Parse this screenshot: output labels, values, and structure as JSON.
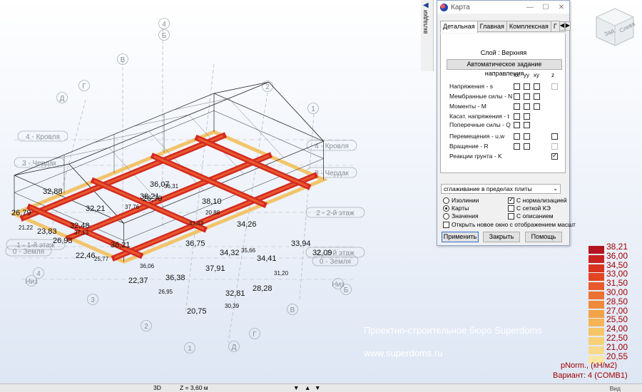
{
  "model": {
    "grid_tags": [
      "4",
      "Б",
      "В",
      "2",
      "Г",
      "Д",
      "1",
      "4 - Кровля",
      "4 - Кровля",
      "3 - Чердак",
      "3 - Чердак",
      "2 - 2-й этаж",
      "2 - 2-й этаж",
      "1 - 1-й этаж",
      "0 - Земля",
      "0 - Земля",
      "Низ",
      "Низ",
      "4",
      "3",
      "2",
      "1",
      "Д",
      "Г",
      "В",
      "Б"
    ],
    "values": [
      "26,79",
      "32,88",
      "21,22",
      "23,83",
      "26,93",
      "37,13",
      "32,48",
      "22,46",
      "25,77",
      "32,21",
      "36,07",
      "36,31",
      "26,79",
      "36,21",
      "37,76",
      "38,21",
      "38,10",
      "43,43",
      "34,26",
      "36,75",
      "35,66",
      "34,32",
      "32,09",
      "36,06",
      "22,37",
      "36,38",
      "26,95",
      "37,91",
      "20,75",
      "30,39",
      "32,81",
      "28,28",
      "31,20",
      "34,41",
      "33,94",
      "20,88"
    ]
  },
  "side_tab": {
    "label": "вкладки"
  },
  "dialog": {
    "title": "Карта",
    "controls": [
      "—",
      "☐",
      "✕"
    ],
    "tabs": [
      "Детальная",
      "Главная",
      "Комплексная",
      "Г"
    ],
    "layer_label": "Слой : Верхняя",
    "auto_button": "Автоматическое задание направления",
    "columns": [
      "xx",
      "yy",
      "xy",
      "z"
    ],
    "rows": [
      {
        "label": "Напряжения - s",
        "cols": [
          "off",
          "off",
          "off",
          "dis"
        ]
      },
      {
        "label": "Мембранные силы - N",
        "cols": [
          "off",
          "off",
          "off",
          "none"
        ]
      },
      {
        "label": "Моменты - M",
        "cols": [
          "off",
          "off",
          "off",
          "none"
        ]
      },
      {
        "label": "Касат. напряжения - t",
        "cols": [
          "off",
          "off",
          "none",
          "none"
        ]
      },
      {
        "label": "Поперечные силы - Q",
        "cols": [
          "off",
          "off",
          "none",
          "none"
        ]
      },
      {
        "label": "Перемещения - u,w",
        "cols": [
          "off",
          "off",
          "none",
          "off"
        ]
      },
      {
        "label": "Вращение - R",
        "cols": [
          "off",
          "off",
          "none",
          "dis"
        ]
      },
      {
        "label": "Реакции грунта - K",
        "cols": [
          "none",
          "none",
          "none",
          "checked"
        ]
      }
    ],
    "smoothing": "сглаживание в пределах плиты",
    "display_modes": [
      {
        "label": "Изолинии",
        "selected": false
      },
      {
        "label": "Карты",
        "selected": true
      },
      {
        "label": "Значения",
        "selected": false
      }
    ],
    "flags": [
      {
        "label": "С нормализацией",
        "checked": true
      },
      {
        "label": "С сеткой КЭ",
        "checked": false
      },
      {
        "label": "С описанием",
        "checked": false
      }
    ],
    "new_window": {
      "label": "Открыть новое окно с отображением масшт",
      "checked": false
    },
    "buttons": {
      "apply": "Применить",
      "close": "Закрыть",
      "help": "Помощь"
    }
  },
  "legend": {
    "values": [
      "38,21",
      "36,00",
      "34,50",
      "33,00",
      "31,50",
      "30,00",
      "28,50",
      "27,00",
      "25,50",
      "24,00",
      "22,50",
      "21,00",
      "20,55"
    ],
    "colors": [
      "#b3141f",
      "#c8221f",
      "#d9321f",
      "#e24424",
      "#e85a2c",
      "#ec7131",
      "#ef8a3a",
      "#f2a247",
      "#f4b556",
      "#f6c566",
      "#f7d077",
      "#f8da8a",
      "#fbe6a6"
    ],
    "unit": "pNorm., (кН/м2)",
    "variant": "Вариант: 4 (COMB1)"
  },
  "navcube": {
    "faces": [
      "Зад",
      "Слева"
    ]
  },
  "watermark": {
    "company": "Проектно-строительное бюро Superdoms",
    "url": "www.superdoms.ru"
  },
  "statusbar": {
    "mode": "3D",
    "z": "Z = 3,60 м",
    "view": "Вид"
  }
}
